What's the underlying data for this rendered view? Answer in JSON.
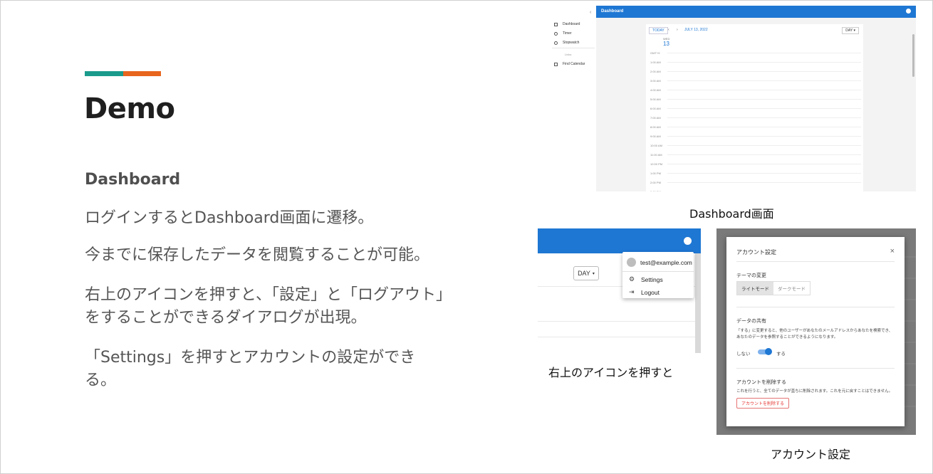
{
  "slide": {
    "title": "Demo",
    "subtitle": "Dashboard",
    "paragraphs": [
      "ログインするとDashboard画面に遷移。",
      "今までに保存したデータを閲覧することが可能。",
      "右上のアイコンを押すと、「設定」と「ログアウト」をすることができるダイアログが出現。",
      "「Settings」を押すとアカウントの設定ができる。"
    ],
    "accent_colors": [
      "#1a9b8c",
      "#e8651e"
    ]
  },
  "captions": {
    "dashboard": "Dashboard画面",
    "menu": "右上のアイコンを押すと",
    "account": "アカウント設定"
  },
  "screenshot_dashboard": {
    "app_title": "Dashboard",
    "sidebar": {
      "items": [
        {
          "label": "Dashboard",
          "icon": "grid-icon"
        },
        {
          "label": "Timer",
          "icon": "clock-icon"
        },
        {
          "label": "Stopwatch",
          "icon": "stopwatch-icon"
        }
      ],
      "section": "Links",
      "link": {
        "label": "Find Calendar",
        "icon": "calendar-icon"
      }
    },
    "toolbar": {
      "today": "TODAY",
      "prev": "‹",
      "next": "›",
      "date": "JULY 13, 2022",
      "view": "DAY ▾"
    },
    "day": {
      "dow": "WED",
      "num": "13"
    },
    "times": [
      "GMT+9",
      "1:00 AM",
      "2:00 AM",
      "3:00 AM",
      "4:00 AM",
      "5:00 AM",
      "6:00 AM",
      "7:00 AM",
      "8:00 AM",
      "9:00 AM",
      "10:00 AM",
      "11:00 AM",
      "12:00 PM",
      "1:00 PM",
      "2:00 PM",
      "3:00 PM",
      "4:00 PM",
      "5:00 PM"
    ]
  },
  "screenshot_menu": {
    "view_select": "DAY",
    "email": "test@example.com",
    "items": [
      {
        "label": "Settings",
        "icon": "gear-icon"
      },
      {
        "label": "Logout",
        "icon": "logout-icon"
      }
    ]
  },
  "screenshot_account": {
    "title": "アカウント設定",
    "close": "×",
    "theme": {
      "heading": "テーマの変更",
      "light": "ライトモード",
      "dark": "ダークモード"
    },
    "share": {
      "heading": "データの共有",
      "text": "「する」に変更すると、他のユーザーがあなたのメールアドレスからあなたを検索でき、あなたのデータを参照することができるようになります。",
      "off": "しない",
      "on": "する",
      "enabled": true
    },
    "delete": {
      "heading": "アカウントを削除する",
      "text": "これを行うと、全てのデータが直ちに削除されます。これを元に戻すことはできません。",
      "button": "アカウントを削除する"
    },
    "colors": {
      "primary": "#1e77d3",
      "danger": "#e53935"
    }
  }
}
